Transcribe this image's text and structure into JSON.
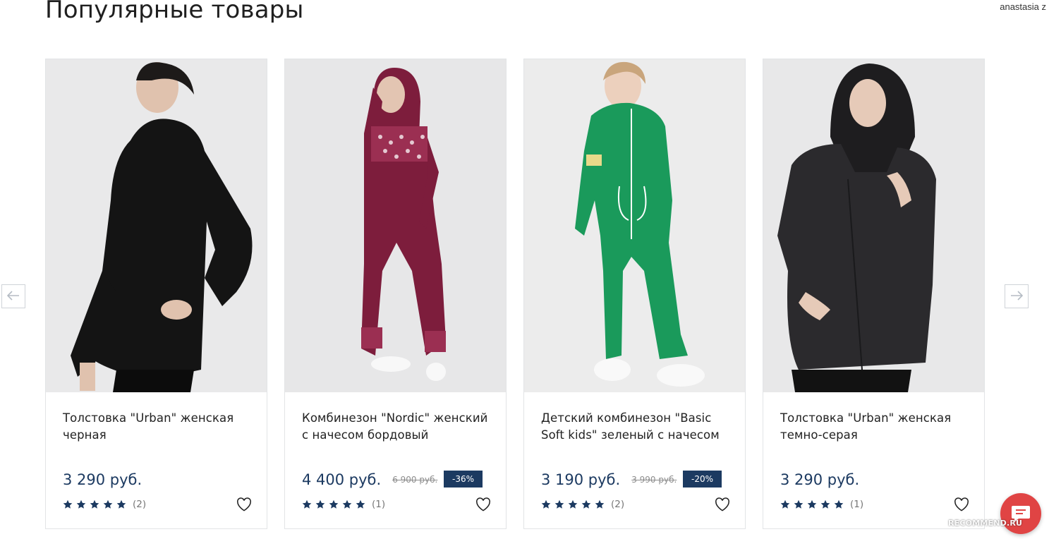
{
  "page": {
    "title": "Популярные товары",
    "user": "anastasia z"
  },
  "colors": {
    "price": "#1c3a61",
    "badge_bg": "#1c3a61",
    "accent_chat": "#e04444"
  },
  "icons": {
    "prev": "arrow-left-icon",
    "next": "arrow-right-icon",
    "wishlist": "heart-icon",
    "star": "star-icon",
    "chat": "chat-icon"
  },
  "products": [
    {
      "name": "Толстовка \"Urban\" женская черная",
      "price": "3 290 руб.",
      "old_price": "",
      "discount": "",
      "rating": 5,
      "reviews": "(2)",
      "photo": "woman in black zip hoodie"
    },
    {
      "name": "Комбинезон \"Nordic\" женский с начесом бордовый",
      "price": "4 400 руб.",
      "old_price": "6 900 руб.",
      "discount": "-36%",
      "rating": 5,
      "reviews": "(1)",
      "photo": "woman in burgundy nordic jumpsuit"
    },
    {
      "name": "Детский комбинезон \"Basic Soft kids\" зеленый с начесом",
      "price": "3 190 руб.",
      "old_price": "3 990 руб.",
      "discount": "-20%",
      "rating": 5,
      "reviews": "(2)",
      "photo": "girl in green jumpsuit"
    },
    {
      "name": "Толстовка \"Urban\" женская темно-серая",
      "price": "3 290 руб.",
      "old_price": "",
      "discount": "",
      "rating": 5,
      "reviews": "(1)",
      "photo": "woman in dark grey hoodie"
    }
  ],
  "watermark": "RECOMMEND.RU"
}
